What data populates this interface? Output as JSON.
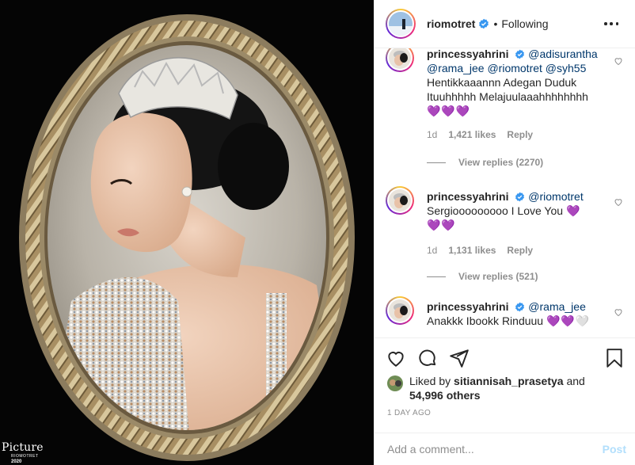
{
  "header": {
    "username": "riomotret",
    "separator": "•",
    "follow_status": "Following"
  },
  "photo": {
    "watermark_main": "Picture",
    "watermark_sub": "RIOMOTRET",
    "watermark_year": "2020"
  },
  "comments": [
    {
      "username": "princessyahrini",
      "mentions": "@adisurantha @rama_jee @riomotret @syh55",
      "text": "Hentikkaaannn Adegan Duduk Ituuhhhhh Melajuulaaahhhhhhhh",
      "emoji": "💜💜💜",
      "age": "1d",
      "likes": "1,421 likes",
      "reply_label": "Reply",
      "view_replies": "View replies (2270)"
    },
    {
      "username": "princessyahrini",
      "mentions": "@riomotret",
      "text": "Sergiooooooooo I Love You",
      "emoji_inline": "💜",
      "emoji": "💜💜",
      "age": "1d",
      "likes": "1,131 likes",
      "reply_label": "Reply",
      "view_replies": "View replies (521)"
    },
    {
      "username": "princessyahrini",
      "mentions": "@rama_jee",
      "text": "Anakkk Ibookk Rinduuu",
      "emoji": "💜💜",
      "emoji_faded": "🤍"
    }
  ],
  "likes": {
    "liked_by_prefix": "Liked by",
    "liked_by_user": "sitiannisah_prasetya",
    "and": "and",
    "others": "54,996 others"
  },
  "timestamp": "1 DAY AGO",
  "add_comment": {
    "placeholder": "Add a comment...",
    "post_label": "Post"
  },
  "colors": {
    "verified": "#3897f0",
    "mention": "#00376b",
    "secondary_text": "#8e8e8e",
    "post_button_disabled": "#b2dffc",
    "heart_purple": "#7b3fe4"
  },
  "icons": [
    "more-options-icon",
    "verified-badge-icon",
    "heart-icon",
    "comment-icon",
    "share-icon",
    "bookmark-icon"
  ]
}
